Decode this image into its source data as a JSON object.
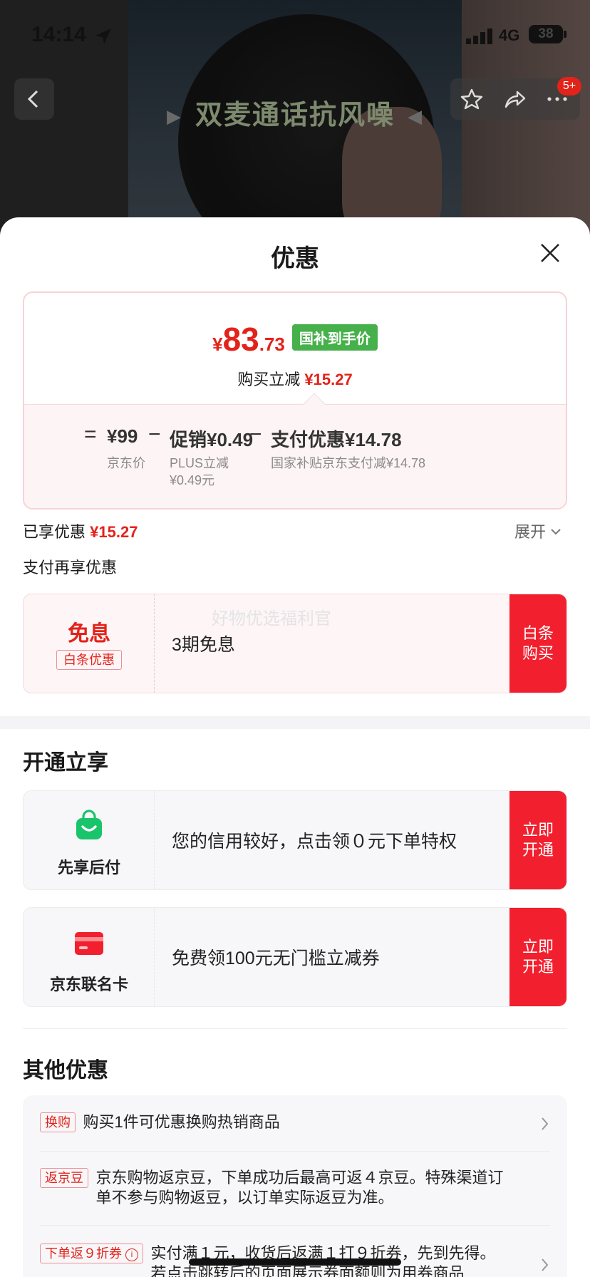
{
  "status_bar": {
    "time": "14:14",
    "network": "4G",
    "battery": "38"
  },
  "video": {
    "title": "双麦通话抗风噪",
    "left_arrow": "▶",
    "right_arrow": "◀"
  },
  "top_badge": "5+",
  "sheet": {
    "title": "优惠",
    "price": {
      "currency": "¥",
      "integer": "83",
      "decimal": ".73",
      "tag": "国补到手价",
      "buy_label": "购买立减",
      "buy_amount": "¥15.27"
    },
    "formula": {
      "eq": "=",
      "jd_price": "¥99",
      "jd_price_label": "京东价",
      "minus1": "−",
      "promo": "促销¥0.49",
      "promo_sub1": "PLUS立减",
      "promo_sub2": "¥0.49元",
      "minus2": "−",
      "pay": "支付优惠¥14.78",
      "pay_sub": "国家补贴京东支付减¥14.78"
    },
    "enjoyed_label": "已享优惠",
    "enjoyed_amount": "¥15.27",
    "expand_label": "展开",
    "pay_again_label": "支付再享优惠",
    "baitiao_offer": {
      "title": "免息",
      "tag": "白条优惠",
      "text": "3期免息",
      "watermark": "好物优选福利官",
      "button": "白条购买"
    },
    "open_section_title": "开通立享",
    "open_offers": [
      {
        "label": "先享后付",
        "text": "您的信用较好，点击领０元下单特权",
        "button": "立即开通",
        "icon": "shopping-bag-icon"
      },
      {
        "label": "京东联名卡",
        "text": "免费领100元无门槛立减券",
        "button": "立即开通",
        "icon": "credit-card-icon"
      }
    ],
    "other_section_title": "其他优惠",
    "other_offers": [
      {
        "tag": "换购",
        "line1": "购买1件可优惠换购热销商品",
        "line2": ""
      },
      {
        "tag": "返京豆",
        "line1": "京东购物返京豆，下单成功后最高可返４京豆。特殊渠道订",
        "line2": "单不参与购物返豆，以订单实际返豆为准。"
      },
      {
        "tag": "下单返９折券",
        "line1": "实付满１元，收货后返满１打９折券，先到先得。",
        "line2": "若点击跳转后的页面展示券面额则为用券商品"
      }
    ]
  },
  "colors": {
    "accent": "#e2231a",
    "button": "#f2202e",
    "tag_green": "#46b04b"
  }
}
